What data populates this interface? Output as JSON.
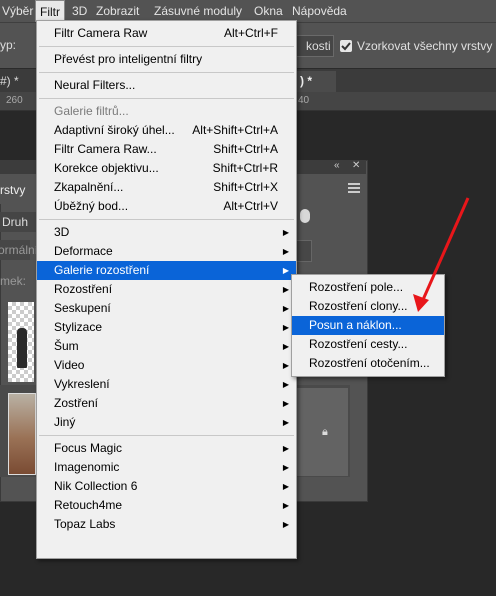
{
  "menubar": {
    "items": [
      "Výběr",
      "Filtr",
      "3D",
      "Zobrazit",
      "Zásuvné moduly",
      "Okna",
      "Nápověda"
    ],
    "active": "Filtr"
  },
  "options_bar": {
    "left_label": "yp:",
    "mid_label": "kosti",
    "sample_all_layers": "Vzorkovat všechny vrstvy",
    "sample_all_checked": true
  },
  "document_tabs": {
    "left": "#) *",
    "right": ") *"
  },
  "ruler": {
    "ticks": [
      "260",
      "40"
    ]
  },
  "layers_panel": {
    "tab_label": "rstvy",
    "filter_kind": "Druh",
    "blend_mode": "ormální",
    "lock_label": "mek:"
  },
  "filter_menu": {
    "items": [
      {
        "label": "Filtr Camera Raw",
        "shortcut": "Alt+Ctrl+F"
      },
      {
        "sep": true
      },
      {
        "label": "Převést pro inteligentní filtry"
      },
      {
        "sep": true
      },
      {
        "label": "Neural Filters..."
      },
      {
        "sep": true
      },
      {
        "label": "Galerie filtrů...",
        "disabled": true
      },
      {
        "label": "Adaptivní široký úhel...",
        "shortcut": "Alt+Shift+Ctrl+A"
      },
      {
        "label": "Filtr Camera Raw...",
        "shortcut": "Shift+Ctrl+A"
      },
      {
        "label": "Korekce objektivu...",
        "shortcut": "Shift+Ctrl+R"
      },
      {
        "label": "Zkapalnění...",
        "shortcut": "Shift+Ctrl+X"
      },
      {
        "label": "Úběžný bod...",
        "shortcut": "Alt+Ctrl+V"
      },
      {
        "sep": true
      },
      {
        "label": "3D",
        "submenu": true
      },
      {
        "label": "Deformace",
        "submenu": true
      },
      {
        "label": "Galerie rozostření",
        "submenu": true,
        "highlighted": true
      },
      {
        "label": "Rozostření",
        "submenu": true
      },
      {
        "label": "Seskupení",
        "submenu": true
      },
      {
        "label": "Stylizace",
        "submenu": true
      },
      {
        "label": "Šum",
        "submenu": true
      },
      {
        "label": "Video",
        "submenu": true
      },
      {
        "label": "Vykreslení",
        "submenu": true
      },
      {
        "label": "Zostření",
        "submenu": true
      },
      {
        "label": "Jiný",
        "submenu": true
      },
      {
        "sep": true
      },
      {
        "label": "Focus Magic",
        "submenu": true
      },
      {
        "label": "Imagenomic",
        "submenu": true
      },
      {
        "label": "Nik Collection 6",
        "submenu": true
      },
      {
        "label": "Retouch4me",
        "submenu": true
      },
      {
        "label": "Topaz Labs",
        "submenu": true
      }
    ]
  },
  "blur_gallery_submenu": {
    "items": [
      {
        "label": "Rozostření pole..."
      },
      {
        "label": "Rozostření clony..."
      },
      {
        "label": "Posun a náklon...",
        "highlighted": true
      },
      {
        "label": "Rozostření cesty..."
      },
      {
        "label": "Rozostření otočením..."
      }
    ]
  },
  "colors": {
    "highlight": "#0a64d8",
    "annotation_arrow": "#e8161a",
    "menu_bg": "#f0f0f0",
    "chrome": "#535353"
  }
}
